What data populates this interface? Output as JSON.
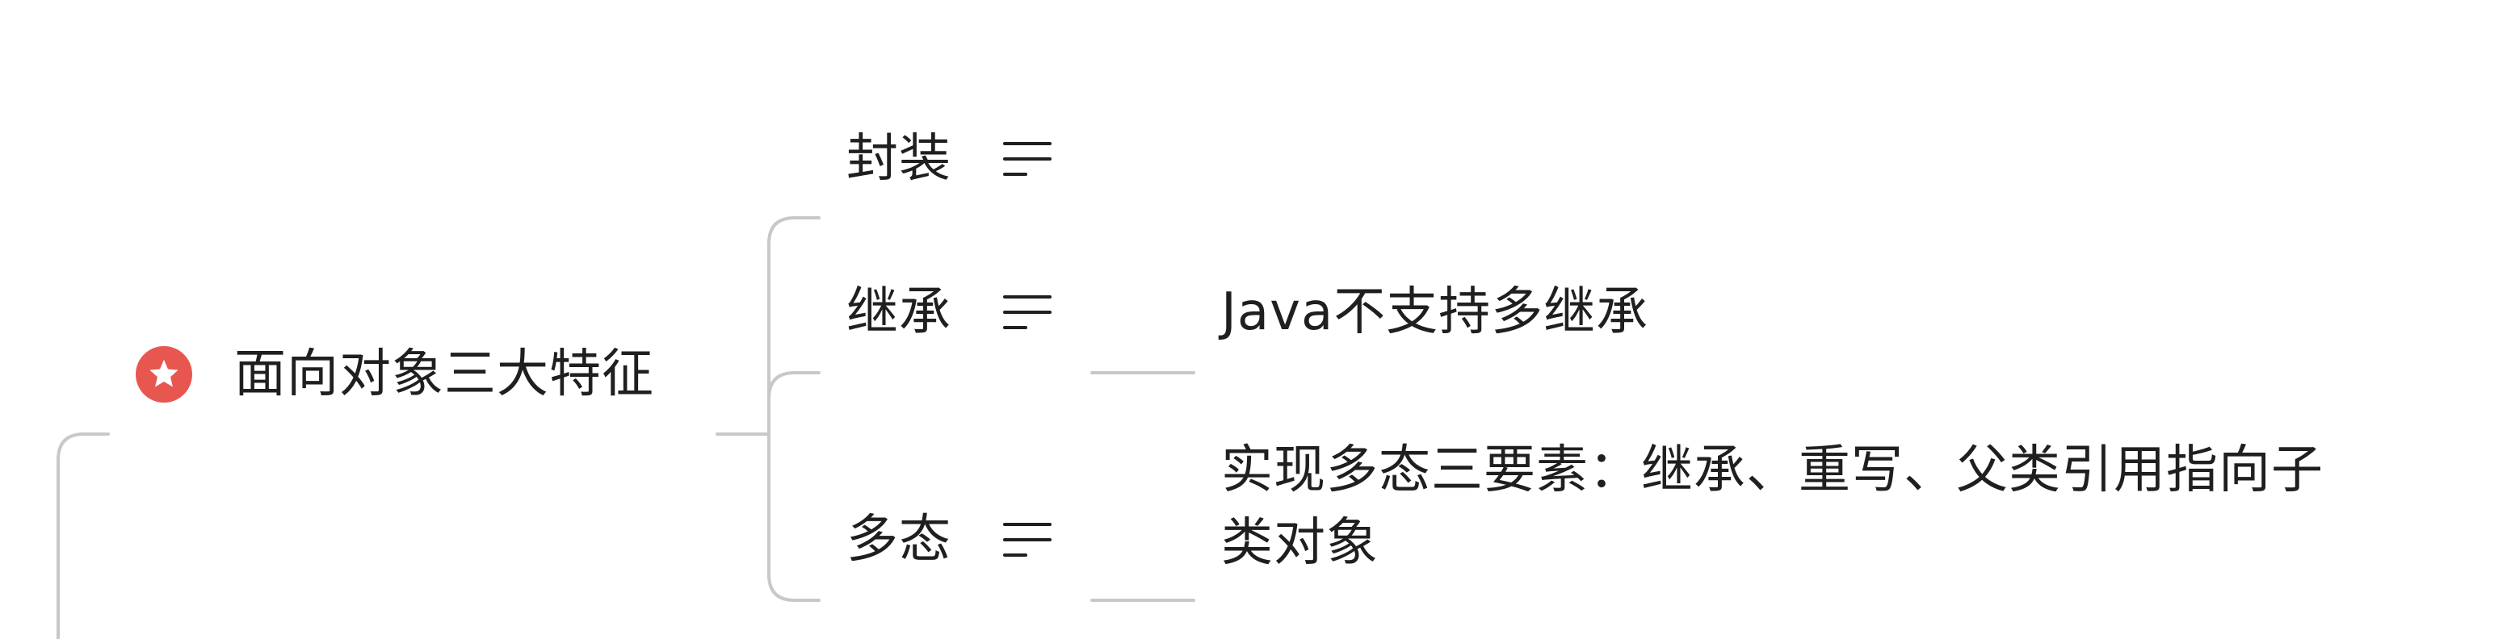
{
  "mindmap": {
    "root": {
      "label": "面向对象三大特征",
      "icon": "star-icon",
      "badge_color": "#e8574f"
    },
    "branches": [
      {
        "label": "封装",
        "icon": "notes-icon"
      },
      {
        "label": "继承",
        "icon": "notes-icon",
        "child": "Java不支持多继承"
      },
      {
        "label": "多态",
        "icon": "notes-icon",
        "child_line1": "实现多态三要素：继承、重写、父类引用指向子",
        "child_line2": "类对象"
      }
    ],
    "connector_color": "#c8c8c8"
  }
}
